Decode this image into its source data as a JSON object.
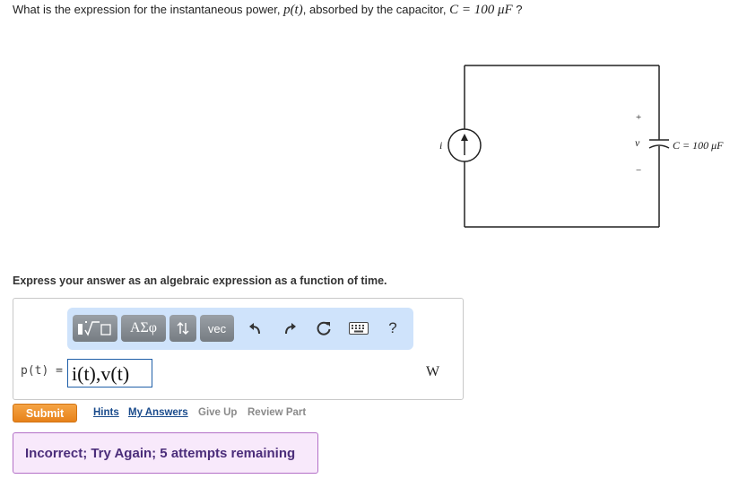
{
  "question": {
    "prefix": "What is the expression for the instantaneous power, ",
    "var": "p(t)",
    "middle": ", absorbed by the capacitor, ",
    "cap": "C = 100 μF",
    "suffix": " ?"
  },
  "circuit": {
    "source_label": "i",
    "voltage_label": "v",
    "plus": "+",
    "minus": "−",
    "cap_label": "C = 100 μF"
  },
  "instruction": "Express your answer as an algebraic expression as a function of time.",
  "toolbar": {
    "greek_label": "ΑΣφ",
    "vec_label": "vec",
    "help_label": "?",
    "icons": [
      "templates-icon",
      "updown-arrows-icon",
      "undo-icon",
      "redo-icon",
      "reset-icon",
      "keyboard-icon",
      "help-icon"
    ]
  },
  "answer": {
    "label": "p(t) =",
    "value": "i(t),v(t)",
    "unit": "W"
  },
  "actions": {
    "submit": "Submit",
    "hints": "Hints",
    "my_answers": "My Answers",
    "give_up": "Give Up",
    "review_part": "Review Part"
  },
  "feedback": {
    "message": "Incorrect; Try Again; 5 attempts remaining",
    "accent": "#f8e9fb",
    "border": "#b370c7"
  },
  "colors": {
    "submit": "#e7821a",
    "link": "#1a4b8c",
    "toolbar_bg": "#cfe3fb",
    "input_border": "#1f5fa8"
  }
}
